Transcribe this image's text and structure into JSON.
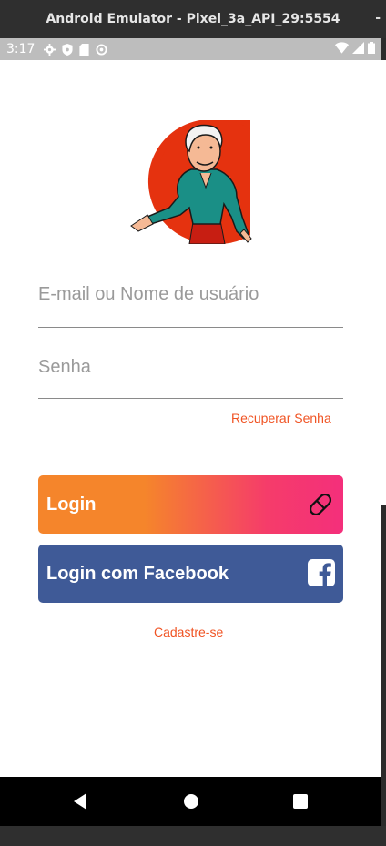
{
  "window": {
    "title": "Android Emulator - Pixel_3a_API_29:5554"
  },
  "status_bar": {
    "time": "3:17"
  },
  "login": {
    "email_placeholder": "E-mail ou Nome de usuário",
    "password_placeholder": "Senha",
    "recover_link": "Recuperar Senha",
    "login_button": "Login",
    "facebook_button": "Login com Facebook",
    "signup_link": "Cadastre-se"
  },
  "colors": {
    "accent": "#f05323",
    "gradient_start": "#f5852b",
    "gradient_end": "#f42f7b",
    "facebook": "#3f5a97"
  },
  "icons": [
    "settings-icon",
    "shield-icon",
    "sd-card-icon",
    "sync-icon",
    "wifi-icon",
    "signal-icon",
    "battery-icon",
    "pill-icon",
    "facebook-icon",
    "back-icon",
    "home-icon",
    "recents-icon"
  ]
}
